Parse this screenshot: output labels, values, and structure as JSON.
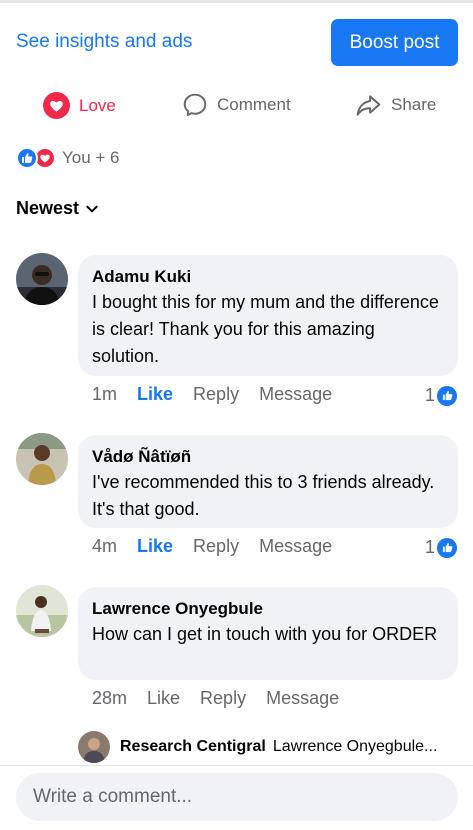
{
  "header": {
    "insights_label": "See insights and ads",
    "boost_label": "Boost post"
  },
  "actions": {
    "love_label": "Love",
    "comment_label": "Comment",
    "share_label": "Share"
  },
  "reactions": {
    "summary": "You + 6",
    "icons": [
      "like-reaction-icon",
      "love-reaction-icon"
    ]
  },
  "sort": {
    "label": "Newest"
  },
  "comments": [
    {
      "author": "Adamu Kuki",
      "text": "I bought this for my mum and the difference is clear! Thank you for this amazing solution.",
      "time": "1m",
      "like_label": "Like",
      "reply_label": "Reply",
      "message_label": "Message",
      "like_count": "1"
    },
    {
      "author": "Vådø Ñâtïøñ",
      "text": "I've recommended this to 3 friends already. It's that good.",
      "time": "4m",
      "like_label": "Like",
      "reply_label": "Reply",
      "message_label": "Message",
      "like_count": "1"
    },
    {
      "author": "Lawrence Onyegbule",
      "text": "How can I get in touch with you for ORDER",
      "time": "28m",
      "like_label": "Like",
      "reply_label": "Reply",
      "message_label": "Message"
    }
  ],
  "reply_preview": {
    "author": "Research Centigral",
    "text": "Lawrence Onyegbule..."
  },
  "composer": {
    "placeholder": "Write a comment..."
  },
  "colors": {
    "accent": "#1877f2",
    "love": "#f02849",
    "bubble": "#f0f2f5",
    "muted": "#65676b"
  }
}
